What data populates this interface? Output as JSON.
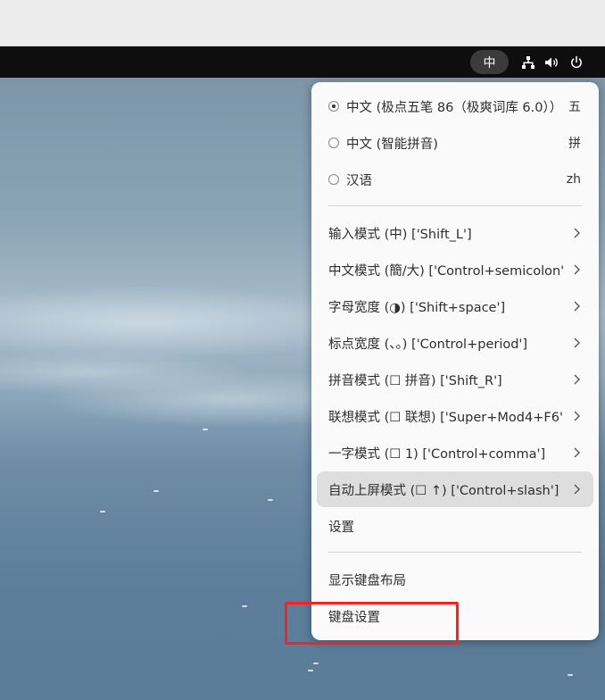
{
  "topbar": {
    "input_indicator": "中",
    "tray_icons": [
      "network-icon",
      "volume-icon",
      "power-icon"
    ]
  },
  "menu": {
    "input_methods": [
      {
        "label": "中文 (极点五笔 86（极爽词库 6.0））",
        "shortcut": "五",
        "selected": true
      },
      {
        "label": "中文 (智能拼音)",
        "shortcut": "拼",
        "selected": false
      },
      {
        "label": "汉语",
        "shortcut": "zh",
        "selected": false
      }
    ],
    "modes": [
      {
        "label": "输入模式 (中) ['Shift_L']"
      },
      {
        "label": "中文模式 (簡/大) ['Control+semicolon']"
      },
      {
        "label": "字母宽度 (◑) ['Shift+space']"
      },
      {
        "label": "标点宽度 (、。) ['Control+period']"
      },
      {
        "label": "拼音模式 (☐ 拼音) ['Shift_R']"
      },
      {
        "label": "联想模式 (☐ 联想) ['Super+Mod4+F6']"
      },
      {
        "label": "一字模式 (☐ 1) ['Control+comma']"
      },
      {
        "label": "自动上屏模式 (☐ ↑) ['Control+slash']"
      }
    ],
    "settings_label": "设置",
    "show_keyboard_layout_label": "显示键盘布局",
    "keyboard_settings_label": "键盘设置"
  },
  "colors": {
    "topbar_bg": "#0e0e0e",
    "menu_bg": "#fafafa",
    "hover_bg": "#dedede",
    "annotation_red": "#ff1f1f"
  }
}
